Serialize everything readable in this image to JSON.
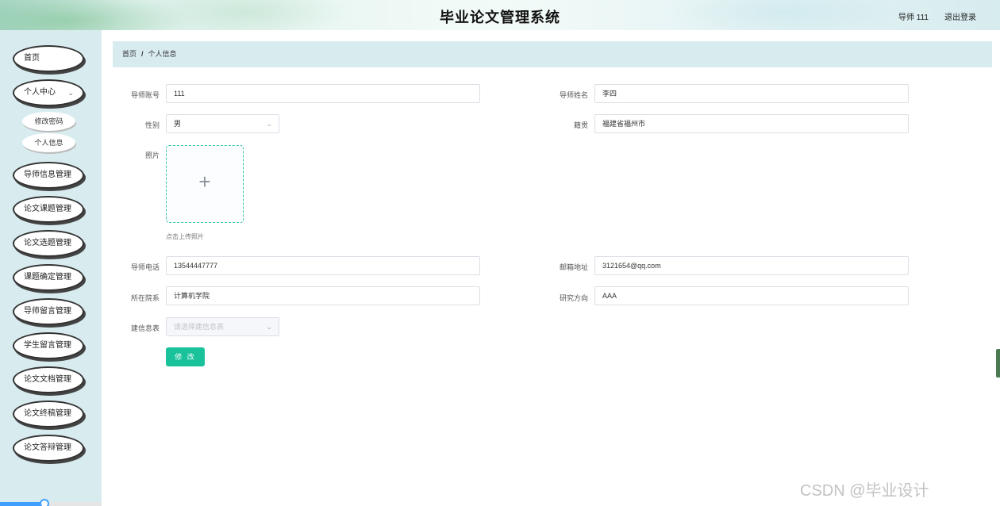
{
  "header": {
    "title": "毕业论文管理系统",
    "user": "导师 111",
    "logout": "退出登录"
  },
  "sidebar": {
    "items": [
      {
        "label": "首页"
      },
      {
        "label": "个人中心",
        "expanded": true
      },
      {
        "label": "导师信息管理"
      },
      {
        "label": "论文课题管理"
      },
      {
        "label": "论文选题管理"
      },
      {
        "label": "课题确定管理"
      },
      {
        "label": "导师留言管理"
      },
      {
        "label": "学生留言管理"
      },
      {
        "label": "论文文档管理"
      },
      {
        "label": "论文终稿管理"
      },
      {
        "label": "论文答辩管理"
      }
    ],
    "sub_items": [
      {
        "label": "修改密码"
      },
      {
        "label": "个人信息"
      }
    ]
  },
  "breadcrumb": {
    "home": "首页",
    "separator": "/",
    "current": "个人信息"
  },
  "form": {
    "account_label": "导师账号",
    "account_value": "111",
    "name_label": "导师姓名",
    "name_value": "李四",
    "gender_label": "性别",
    "gender_value": "男",
    "origin_label": "籍贯",
    "origin_value": "福建省福州市",
    "photo_label": "照片",
    "photo_tip": "点击上传照片",
    "phone_label": "导师电话",
    "phone_value": "13544447777",
    "email_label": "邮箱地址",
    "email_value": "3121654@qq.com",
    "dept_label": "所在院系",
    "dept_value": "计算机学院",
    "research_label": "研究方向",
    "research_value": "AAA",
    "table_label": "建信息表",
    "table_placeholder": "请选择建信息表",
    "submit_label": "修 改"
  },
  "watermark": "CSDN @毕业设计",
  "colors": {
    "sidebar_bg": "#d8ecf0",
    "primary": "#19c29b",
    "upload_border": "#2ec4a6"
  }
}
